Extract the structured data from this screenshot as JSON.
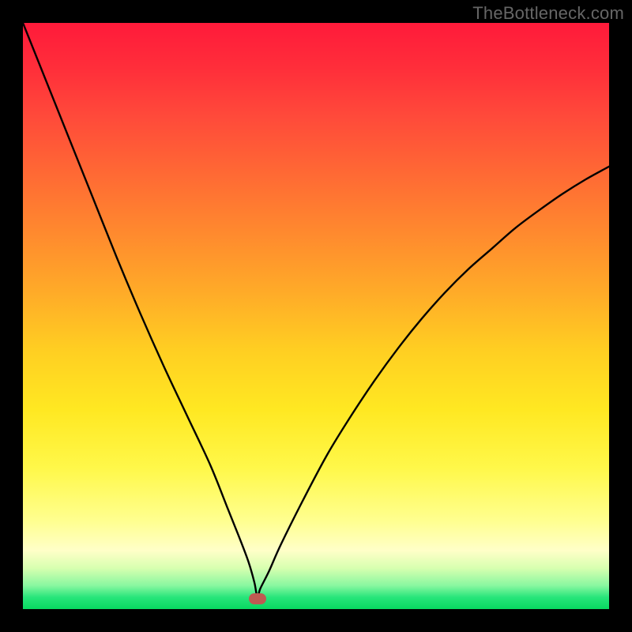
{
  "watermark": "TheBottleneck.com",
  "colors": {
    "frame": "#000000",
    "curve": "#000000",
    "marker": "#bf5a52",
    "gradient_stops": [
      "#ff1a3a",
      "#ff2f3a",
      "#ff4a3a",
      "#ff6a34",
      "#ff8a2e",
      "#ffab28",
      "#ffcf22",
      "#ffe822",
      "#fff84a",
      "#ffff90",
      "#ffffc8",
      "#d8ffb0",
      "#88f7a0",
      "#27e57a",
      "#08d860"
    ]
  },
  "chart_data": {
    "type": "line",
    "title": "",
    "xlabel": "",
    "ylabel": "",
    "xlim": [
      0,
      100
    ],
    "ylim": [
      0,
      100
    ],
    "marker": {
      "x": 40,
      "y": 1.8
    },
    "series": [
      {
        "name": "curve",
        "x": [
          0,
          4,
          8,
          12,
          16,
          20,
          24,
          28,
          32,
          35,
          37,
          38.5,
          39.5,
          40,
          40.5,
          42,
          44,
          48,
          52,
          56,
          60,
          64,
          68,
          72,
          76,
          80,
          84,
          88,
          92,
          96,
          100
        ],
        "y": [
          100,
          90,
          80,
          70,
          60,
          50.5,
          41.5,
          33,
          24.5,
          17,
          12,
          8,
          4.5,
          2,
          3.5,
          6.5,
          11,
          19,
          26.5,
          33,
          39,
          44.5,
          49.5,
          54,
          58,
          61.5,
          65,
          68,
          70.8,
          73.3,
          75.5
        ]
      }
    ]
  }
}
